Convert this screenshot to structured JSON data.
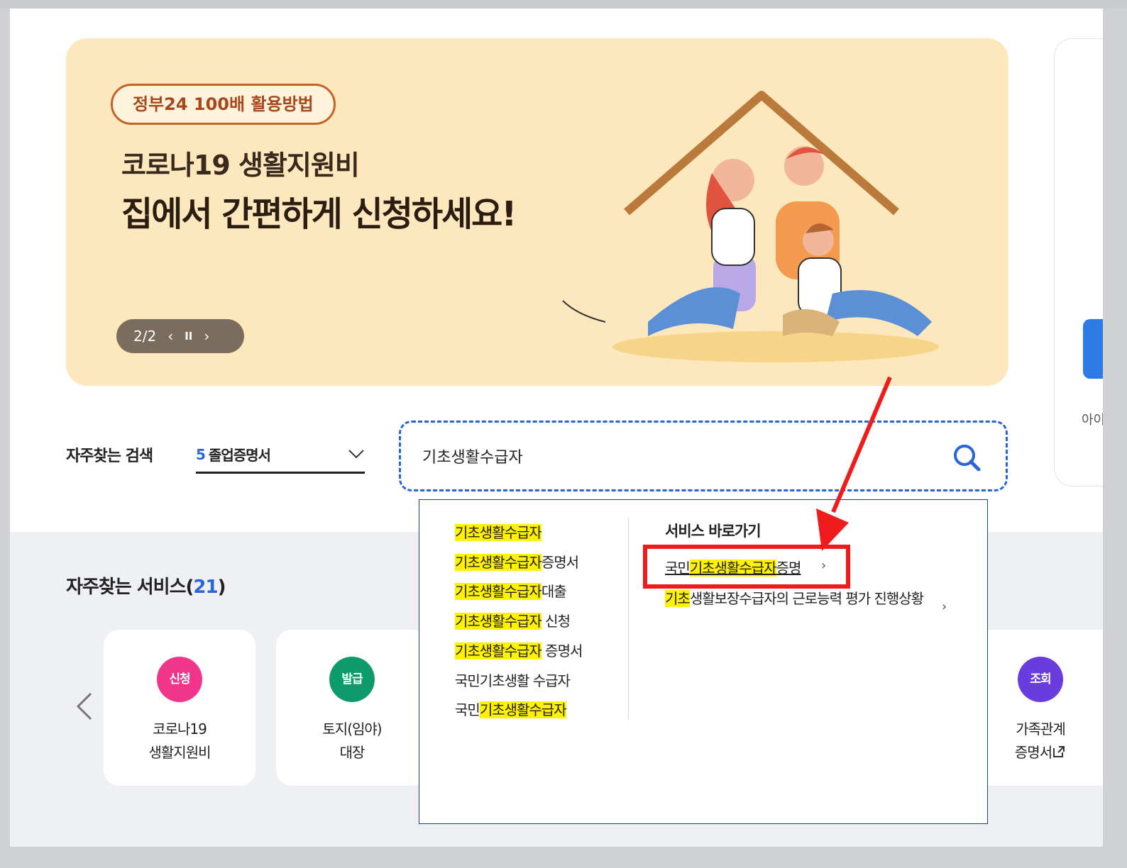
{
  "banner": {
    "badge": "정부24 100배 활용방법",
    "title_line1": "코로나19 생활지원비",
    "title_line2": "집에서 간편하게 신청하세요!",
    "pager": "2/2",
    "prev_symbol": "‹",
    "pause_symbol": "II",
    "next_symbol": "›"
  },
  "side": {
    "partial_text": "아이디"
  },
  "search": {
    "frequent_label": "자주찾는 검색",
    "frequent_rank": "5",
    "frequent_term": "졸업증명서",
    "query_value": "기초생활수급자"
  },
  "autocomplete": {
    "suggestions": [
      {
        "highlight": "기초생활수급자",
        "rest": ""
      },
      {
        "highlight": "기초생활수급자",
        "rest": "증명서"
      },
      {
        "highlight": "기초생활수급자",
        "rest": "대출"
      },
      {
        "highlight": "기초생활수급자",
        "rest": " 신청"
      },
      {
        "highlight": "기초생활수급자",
        "rest": " 증명서"
      },
      {
        "prefix": "국민기초생활 수급자",
        "highlight": "",
        "rest": ""
      },
      {
        "prefix": "국민",
        "highlight": "기초생활수급자",
        "rest": ""
      }
    ],
    "service_title": "서비스 바로가기",
    "service_items": [
      {
        "prefix": "국민",
        "highlight": "기초생활수급자",
        "rest": "증명"
      },
      {
        "prefix": "",
        "highlight": "기초",
        "rest": "생활보장수급자의 근로능력 평가 진행상황"
      }
    ],
    "chevron": "›"
  },
  "services": {
    "heading": "자주찾는 서비스(",
    "count": "21",
    "heading_close": ")",
    "cards": [
      {
        "badge": "신청",
        "badge_color": "#f0358b",
        "line1": "코로나19",
        "line2": "생활지원비"
      },
      {
        "badge": "발급",
        "badge_color": "#0e9a6b",
        "line1": "토지(임야)",
        "line2": "대장"
      },
      {
        "badge": "조회",
        "badge_color": "#6a3ce0",
        "line1": "가족관계",
        "line2": "증명서"
      }
    ]
  },
  "colors": {
    "accent": "#2a66d6",
    "highlight": "#fff200",
    "annotation": "#ee1c1c",
    "banner_bg": "#fde8bd"
  }
}
